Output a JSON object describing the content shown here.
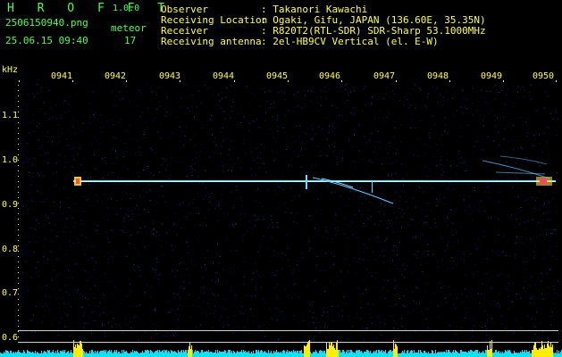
{
  "header": {
    "app_name": "H R O F F T",
    "version": "1.0.0",
    "filename": "2506150940.png",
    "datetime": "25.06.15 09:40",
    "meteor_label": "meteor",
    "meteor_count": "17"
  },
  "station": {
    "rows": [
      {
        "key": "Observer",
        "value": ": Takanori Kawachi"
      },
      {
        "key": "Receiving Location",
        "value": ": Ogaki, Gifu, JAPAN (136.60E, 35.35N)"
      },
      {
        "key": "Receiver",
        "value": ": R820T2(RTL-SDR) SDR-Sharp 53.1000MHz"
      },
      {
        "key": "Receiving antenna",
        "value": ": 2el-HB9CV Vertical (el. E-W)"
      }
    ]
  },
  "axes": {
    "y_unit": "kHz",
    "y_ticks": [
      "1.1",
      "1.0",
      "0.9",
      "0.8",
      "0.7",
      "0.6"
    ],
    "x_ticks": [
      "0941",
      "0942",
      "0943",
      "0944",
      "0945",
      "0946",
      "0947",
      "0948",
      "0949",
      "0950"
    ]
  },
  "colors": {
    "background": "#000000",
    "text_green": "#4cff4c",
    "text_yellow": "#ffff40",
    "signal_line": "#66ddff",
    "noise_floor": "#00e5ff",
    "noise_spike": "#ffee00",
    "guide_lines": "#d0d0d0"
  }
}
